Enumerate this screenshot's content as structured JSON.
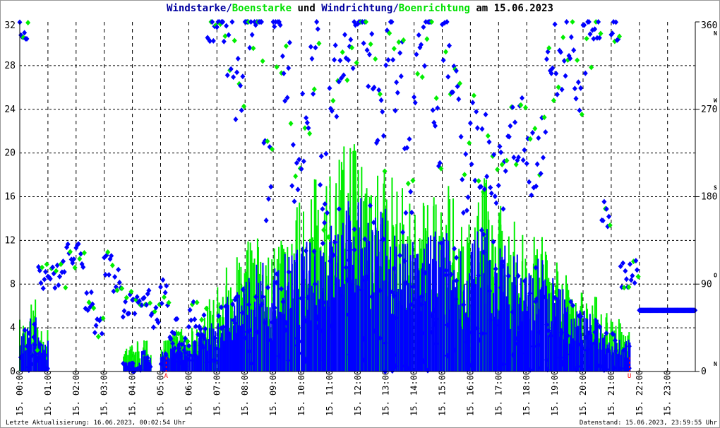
{
  "title": {
    "wind": "Windstarke/",
    "gust": "Boenstarke",
    "and": " und ",
    "dir": "Windrichtung/",
    "gustdir": "Boenrichtung",
    "date": " am 15.06.2023"
  },
  "footer": {
    "left": "Letzte Aktualisierung: 16.06.2023, 00:02:54 Uhr",
    "right": "Datenstand: 15.06.2023, 23:59:55 Uhr"
  },
  "colors": {
    "wind": "#0000ff",
    "gust": "#00ee00",
    "grid": "#000000",
    "sun": "#ff0000"
  },
  "chart_data": {
    "type": "line",
    "title": "Windstarke/Boenstarke und Windrichtung/Boenrichtung am 15.06.2023",
    "ylim": [
      0,
      32
    ],
    "yticks": [
      "0",
      "4",
      "8",
      "12",
      "16",
      "20",
      "24",
      "28",
      "32"
    ],
    "y2lim": [
      0,
      360
    ],
    "y2ticks": [
      "0",
      "90",
      "180",
      "270",
      "360"
    ],
    "y2compass": [
      "N",
      "O",
      "S",
      "W",
      "N"
    ],
    "xticks": [
      "15. 00:00",
      "15. 01:00",
      "15. 02:00",
      "15. 03:00",
      "15. 04:00",
      "15. 05:00",
      "15. 06:00",
      "15. 07:00",
      "15. 08:00",
      "15. 09:00",
      "15. 10:00",
      "15. 11:00",
      "15. 12:00",
      "15. 13:00",
      "15. 14:00",
      "15. 15:00",
      "15. 16:00",
      "15. 17:00",
      "15. 18:00",
      "15. 19:00",
      "15. 20:00",
      "15. 21:00",
      "15. 22:00",
      "15. 23:00"
    ],
    "x_interval_minutes": 20,
    "markers": [
      {
        "label": "A",
        "hour": 5.2
      },
      {
        "label": "U",
        "hour": 21.65
      }
    ],
    "series": [
      {
        "name": "Windstarke",
        "values": [
          4,
          5,
          3,
          0,
          0,
          0,
          0,
          0,
          0,
          0,
          0,
          1,
          1,
          2,
          0,
          2,
          3,
          3,
          3,
          4,
          5,
          6,
          7,
          8,
          9,
          10,
          8,
          10,
          11,
          12,
          12,
          13,
          14,
          14,
          16,
          18,
          17,
          16,
          15,
          14,
          13,
          12,
          12,
          13,
          14,
          13,
          12,
          11,
          13,
          14,
          12,
          12,
          11,
          10,
          10,
          11,
          9,
          8,
          7,
          6,
          6,
          5,
          4,
          4,
          3,
          0,
          0,
          0,
          0,
          0,
          0,
          0
        ]
      },
      {
        "name": "Boenstarke",
        "values": [
          5,
          7,
          4,
          0,
          0,
          0,
          0,
          0,
          0,
          0,
          0,
          3,
          3,
          3,
          0,
          3,
          4,
          4,
          4,
          6,
          7,
          8,
          10,
          11,
          12,
          14,
          11,
          14,
          15,
          16,
          16,
          18,
          19,
          19,
          21,
          23,
          22,
          21,
          20,
          19,
          17,
          16,
          16,
          17,
          18,
          17,
          16,
          15,
          17,
          18,
          16,
          16,
          14,
          13,
          13,
          14,
          12,
          11,
          9,
          8,
          8,
          7,
          6,
          5,
          4,
          0,
          0,
          0,
          0,
          0,
          0,
          0
        ]
      },
      {
        "name": "Windrichtung",
        "unit": "deg",
        "values": [
          355,
          30,
          100,
          95,
          100,
          118,
          118,
          75,
          40,
          110,
          95,
          70,
          70,
          75,
          60,
          80,
          40,
          30,
          60,
          50,
          350,
          340,
          345,
          300,
          350,
          355,
          200,
          350,
          300,
          220,
          250,
          330,
          180,
          300,
          340,
          350,
          355,
          320,
          250,
          340,
          300,
          200,
          320,
          350,
          250,
          330,
          300,
          200,
          240,
          220,
          210,
          210,
          230,
          260,
          210,
          220,
          290,
          320,
          330,
          300,
          340,
          350,
          160,
          355,
          100,
          100,
          63,
          63,
          63,
          63,
          63,
          63
        ]
      }
    ]
  }
}
